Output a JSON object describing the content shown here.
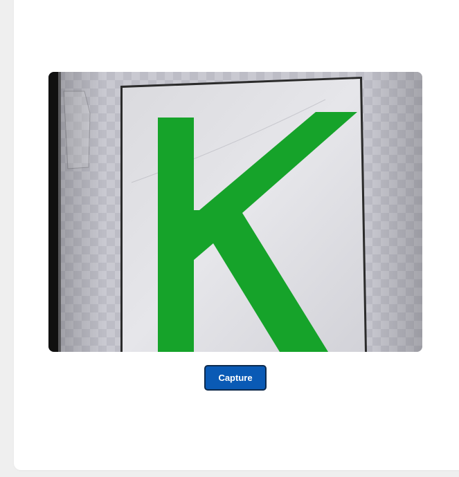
{
  "camera": {
    "preview_subject": "green-letter-card"
  },
  "controls": {
    "capture_label": "Capture"
  },
  "colors": {
    "button_bg": "#0a5ab5",
    "button_border": "#0d2a4d",
    "letter_green": "#16a32a",
    "card_bg": "#ffffff",
    "page_bg": "#efefef"
  }
}
